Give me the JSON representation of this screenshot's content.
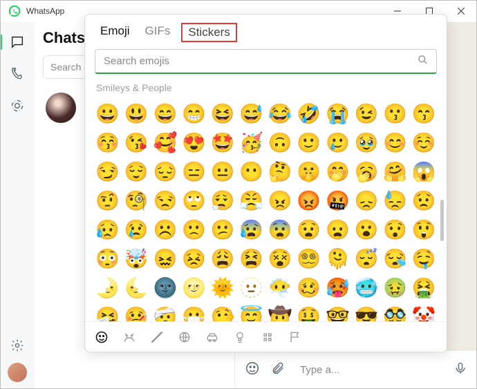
{
  "app": {
    "name": "WhatsApp"
  },
  "chatcol": {
    "title": "Chats",
    "search_placeholder": "Search or start a new chat"
  },
  "composer": {
    "placeholder": "Type a..."
  },
  "popup": {
    "tabs": {
      "emoji": "Emoji",
      "gifs": "GIFs",
      "stickers": "Stickers"
    },
    "search_placeholder": "Search emojis",
    "category_label": "Smileys & People",
    "emojis": [
      "😀",
      "😃",
      "😄",
      "😁",
      "😆",
      "😅",
      "😂",
      "🤣",
      "😭",
      "😉",
      "😗",
      "😙",
      "😚",
      "😘",
      "🥰",
      "😍",
      "🤩",
      "🥳",
      "🙃",
      "🙂",
      "🥲",
      "🥹",
      "😊",
      "☺️",
      "😏",
      "😌",
      "😔",
      "😑",
      "😐",
      "😶",
      "🤔",
      "🤫",
      "🤭",
      "🥱",
      "🤗",
      "😱",
      "🤨",
      "🧐",
      "😒",
      "🙄",
      "😮‍💨",
      "😤",
      "😠",
      "😡",
      "🤬",
      "😞",
      "😓",
      "😟",
      "😥",
      "😢",
      "☹️",
      "🙁",
      "😕",
      "😰",
      "😨",
      "😧",
      "😦",
      "😮",
      "😯",
      "😲",
      "😳",
      "🤯",
      "😖",
      "😣",
      "😩",
      "😫",
      "😵",
      "😵‍💫",
      "🫠",
      "😴",
      "😪",
      "🤤",
      "🌛",
      "🌜",
      "🌚",
      "🌝",
      "🌞",
      "🫥",
      "😶‍🌫️",
      "🥴",
      "🥵",
      "🥶",
      "🤢",
      "🤮",
      "🤧",
      "🤒",
      "🤕",
      "😷",
      "🤥",
      "😇",
      "🤠",
      "🤑",
      "🤓",
      "😎",
      "🥸",
      "🤡"
    ],
    "categories": [
      "smileys",
      "animals",
      "food",
      "activities",
      "travel",
      "objects",
      "symbols",
      "flags"
    ]
  }
}
